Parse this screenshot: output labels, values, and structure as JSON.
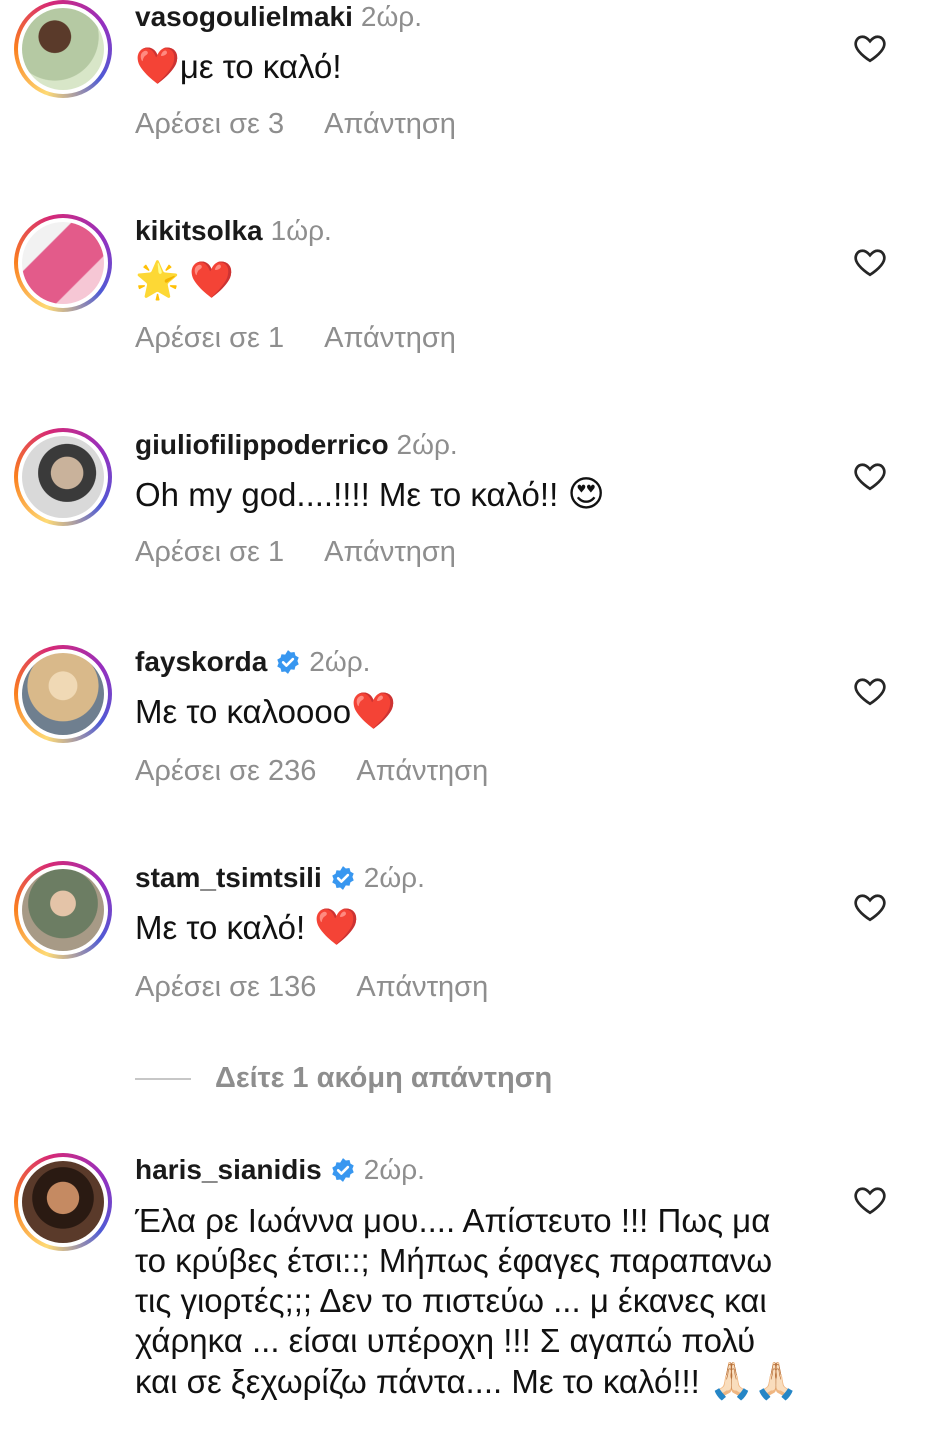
{
  "comments": [
    {
      "username": "vasogoulielmaki",
      "time": "2ώρ.",
      "verified": false,
      "text": "με το καλό!",
      "lead": "❤️",
      "trail": "",
      "likes": "Αρέσει σε 3",
      "reply": "Απάντηση",
      "avatar": "#b5c9a3"
    },
    {
      "username": "kikitsolka",
      "time": "1ώρ.",
      "verified": false,
      "text": "",
      "lead": "🌟",
      "trail": "❤️",
      "likes": "Αρέσει σε 1",
      "reply": "Απάντηση",
      "avatar": "#e35b8a"
    },
    {
      "username": "giuliofilippoderrico",
      "time": "2ώρ.",
      "verified": false,
      "text": "Oh my god....!!!! Με το καλό!!",
      "lead": "",
      "trail": "😍",
      "likes": "Αρέσει σε 1",
      "reply": "Απάντηση",
      "avatar": "#9a9a9a"
    },
    {
      "username": "fayskorda",
      "time": "2ώρ.",
      "verified": true,
      "text": "Με το καλοοοο",
      "lead": "",
      "trail": "❤️",
      "likes": "Αρέσει σε 236",
      "reply": "Απάντηση",
      "avatar": "#d9b98a"
    },
    {
      "username": "stam_tsimtsili",
      "time": "2ώρ.",
      "verified": true,
      "text": "Με το καλό!",
      "lead": "",
      "trail": "❤️",
      "likes": "Αρέσει σε 136",
      "reply": "Απάντηση",
      "avatar": "#6c7d63"
    },
    {
      "username": "haris_sianidis",
      "time": "2ώρ.",
      "verified": true,
      "text": "Έλα ρε Ιωάννα μου.... Απίστευτο !!! Πως μα το κρύβες έτσι::; Μήπως έφαγες παραπανω τις γιορτές;;; Δεν το πιστεύω ... μ έκανες και χάρηκα ... είσαι υπέροχη !!! Σ αγαπώ πολύ και σε ξεχωρίζω πάντα.... Με το καλό!!!",
      "lead": "",
      "trail": "🙏🏻🙏🏻",
      "likes": "",
      "reply": "",
      "avatar": "#5a3a2a"
    }
  ],
  "more_replies": "Δείτε 1 ακόμη απάντηση",
  "icons": {
    "like": "heart-outline-icon",
    "verified": "verified-badge-icon"
  },
  "colors": {
    "verified": "#3897f0",
    "muted": "#8e8e8e",
    "heart_emoji": "#e0102a"
  }
}
